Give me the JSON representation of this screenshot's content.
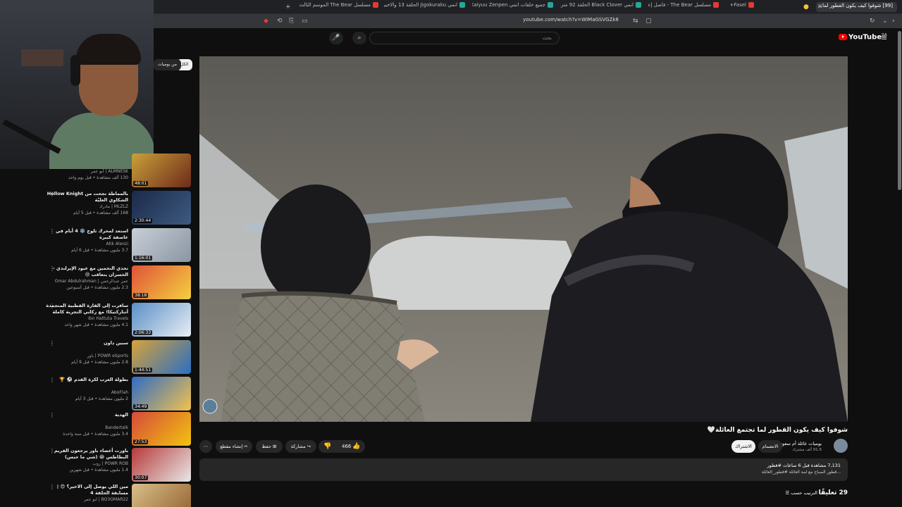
{
  "browser": {
    "tabs": [
      {
        "label": "Fasel+",
        "color": "#e53935"
      },
      {
        "label": "مسلسل The Bear - فاصل إعلاني",
        "color": "#e53935"
      },
      {
        "label": "انمي Black Clover الحلقة 92 مترجمة او",
        "color": "#26a69a"
      },
      {
        "label": "جميع حلقات انمي Kaiyuu Zenpen",
        "color": "#26a69a"
      },
      {
        "label": "انمي Jigokuraku الحلقة 13 والاخيرة مت",
        "color": "#26a69a"
      },
      {
        "label": "مسلسل The Bear الموسم الثالث الحلقة",
        "color": "#e53935"
      }
    ],
    "active_tab": "[99] شوفوا كيف يكون القطور لما...",
    "url": "youtube.com/watch?v=WIMaGSVGZk8"
  },
  "youtube": {
    "logo": "YouTube",
    "logo_region": "SA",
    "search_placeholder": "بحث"
  },
  "chips": {
    "all": "الكل",
    "from_channel": "من يوميات"
  },
  "recommendations": [
    {
      "title": "",
      "channel": "ALMNESK | أبو عمر",
      "meta": "130 ألف مشاهدة • قبل يوم واحد",
      "duration": "48:01",
      "thumb": "#c9a13a"
    },
    {
      "title": "بالمماطة نجحت من Hollow Knight الشكاوي العليّة",
      "channel": "MLZLZ | مادراد",
      "meta": "168 ألف مشاهدة • قبل 5 أيام",
      "duration": "2:30:44",
      "thumb": "#1b2a4a"
    },
    {
      "title": "استعد لمحرك ثلوج ❄️ 4 أيام في عاصفة كبيرة",
      "channel": "Atik Alenzi",
      "meta": "3.7 مليون مشاهدة • قبل 6 أيام",
      "duration": "1:16:01",
      "thumb": "#c8ced6"
    },
    {
      "title": "تحدي التخمين مع عبود الإيرلندي - الخسران يتعاقب 😢",
      "channel": "عمر عبدالرحمن | Omar Abdulrahman",
      "meta": "2.3 مليون مشاهدة • قبل أسبوعين",
      "duration": "38:18",
      "thumb": "#e0533a"
    },
    {
      "title": "سافرت إلى القارة القطبية المتجمدة أنتاركتيكا! مع ركابي التجربة كاملة",
      "channel": "Ibn Hattuta Travels",
      "meta": "4.1 مليون مشاهدة • قبل شهر واحد",
      "duration": "2:06:33",
      "thumb": "#5b8fc7"
    },
    {
      "title": "سبين داون",
      "channel": "POWR eSports | باور",
      "meta": "2.8 مليون مشاهدة • قبل 9 أيام",
      "duration": "1:44:51",
      "thumb": "#d8a23a"
    },
    {
      "title": "بطولة العرب لكرة القدم ⚽ 🏆",
      "channel": "AboFlah",
      "meta": "2 مليون مشاهدة • قبل 3 أيام",
      "duration": "34:49",
      "thumb": "#2f6cc5"
    },
    {
      "title": "الهدية",
      "channel": "Bandertalk",
      "meta": "3.4 مليون مشاهدة • قبل سنة واحدة",
      "duration": "27:53",
      "thumb": "#d64a3a"
    },
    {
      "title": "باورت أعضاء باور يرجعون الفريم البطاطس 😂 (شي ما خبس)",
      "channel": "POWR ROB | روب",
      "meta": "1.4 مليون مشاهدة • قبل شهرين",
      "duration": "30:07",
      "thumb": "#b73a3a"
    },
    {
      "title": "مين اللي يوصل إلى الاخير؟ 😍 | مسابقة الحلقة 4",
      "channel": "BO3OMAR22 | ابو عمر",
      "meta": "",
      "duration": "",
      "thumb": "#d8c08a"
    }
  ],
  "video": {
    "title": "شوفوا كيف يكون القطور لما تجتمع العائلة🤍",
    "channel": "يوميات عائلة أم سعود",
    "subscribers": "91.6 ألف مشترك",
    "join": "الانضمام",
    "subscribe": "الاشتراك",
    "likes": "466",
    "share": "مشاركة",
    "save": "حفظ",
    "clip": "إنشاء مقطع",
    "views_line": "7,131 مشاهدة قبل 6 ساعات  #قطور",
    "desc_line": "...قطور الصباح مع لمة العائلة #قطور_العائلة"
  },
  "comments": {
    "count_label": "29 تعليقًا",
    "sort_label": "الترتيب حسب"
  }
}
